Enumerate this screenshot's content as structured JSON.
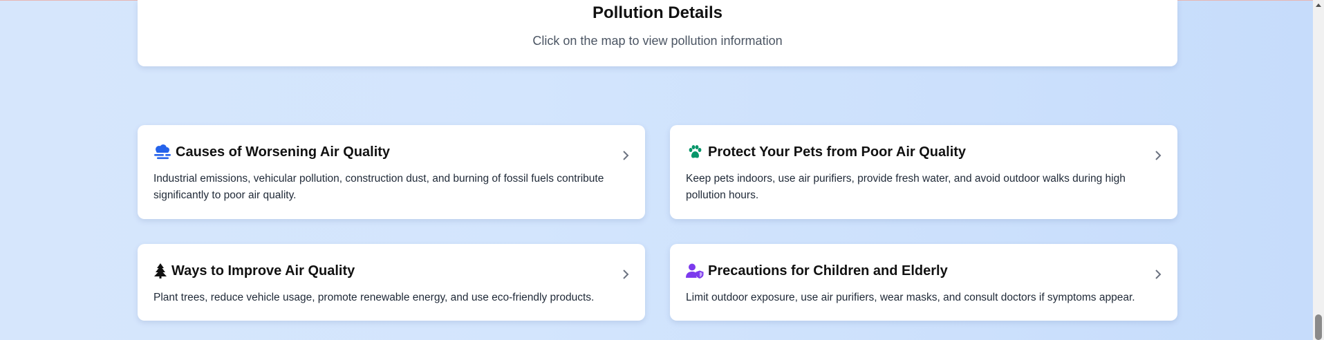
{
  "details": {
    "title": "Pollution Details",
    "subtitle": "Click on the map to view pollution information"
  },
  "cards": [
    {
      "icon": "smog-icon",
      "title": "Causes of Worsening Air Quality",
      "text": "Industrial emissions, vehicular pollution, construction dust, and burning of fossil fuels contribute significantly to poor air quality.",
      "icon_color": "#2563eb"
    },
    {
      "icon": "paw-icon",
      "title": "Protect Your Pets from Poor Air Quality",
      "text": "Keep pets indoors, use air purifiers, provide fresh water, and avoid outdoor walks during high pollution hours.",
      "icon_color": "#059669"
    },
    {
      "icon": "tree-icon",
      "title": "Ways to Improve Air Quality",
      "text": "Plant trees, reduce vehicle usage, promote renewable energy, and use eco-friendly products.",
      "icon_color": "#111111"
    },
    {
      "icon": "user-shield-icon",
      "title": "Precautions for Children and Elderly",
      "text": "Limit outdoor exposure, use air purifiers, wear masks, and consult doctors if symptoms appear.",
      "icon_color": "#7c3aed"
    }
  ],
  "colors": {
    "background": "#d3e5fd",
    "card": "#ffffff",
    "chevron": "#6b7280"
  }
}
